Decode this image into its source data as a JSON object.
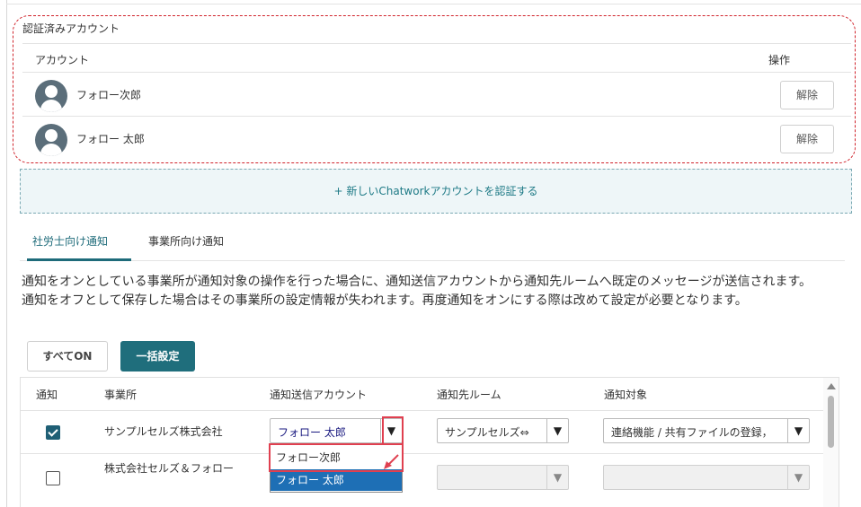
{
  "auth": {
    "title": "認証済みアカウント",
    "col_account": "アカウント",
    "col_operation": "操作",
    "accounts": [
      {
        "name": "フォロー次郎",
        "action": "解除"
      },
      {
        "name": "フォロー 太郎",
        "action": "解除"
      }
    ],
    "highlight_color": "#d0232b"
  },
  "add_account_label": "+ 新しいChatworkアカウントを認証する",
  "tabs": [
    {
      "label": "社労士向け通知",
      "active": true
    },
    {
      "label": "事業所向け通知",
      "active": false
    }
  ],
  "description": {
    "line1": "通知をオンとしている事業所が通知対象の操作を行った場合に、通知送信アカウントから通知先ルームへ既定のメッセージが送信されます。",
    "line2": "通知をオフとして保存した場合はその事業所の設定情報が失われます。再度通知をオンにする際は改めて設定が必要となります。"
  },
  "buttons": {
    "all_on": "すべてON",
    "bulk_set": "一括設定"
  },
  "table": {
    "headers": {
      "notify": "通知",
      "office": "事業所",
      "sender": "通知送信アカウント",
      "room": "通知先ルーム",
      "target": "通知対象"
    },
    "rows": [
      {
        "checked": true,
        "office": "サンプルセルズ株式会社",
        "sender": "フォロー 太郎",
        "room": "サンプルセルズ⇔",
        "target": "連絡機能 / 共有ファイルの登録，"
      },
      {
        "checked": false,
        "office": "株式会社セルズ＆フォロー",
        "sender": "",
        "room": "",
        "target": ""
      }
    ],
    "dropdown_options": [
      "フォロー次郎",
      "フォロー 太郎"
    ],
    "dropdown_selected": "フォロー 太郎"
  },
  "icons": {
    "select_arrow": "▼",
    "avatar": "user-avatar-icon"
  },
  "colors": {
    "accent": "#1f6e7c",
    "selection": "#1e6fb5",
    "annotation_red": "#e04050"
  }
}
